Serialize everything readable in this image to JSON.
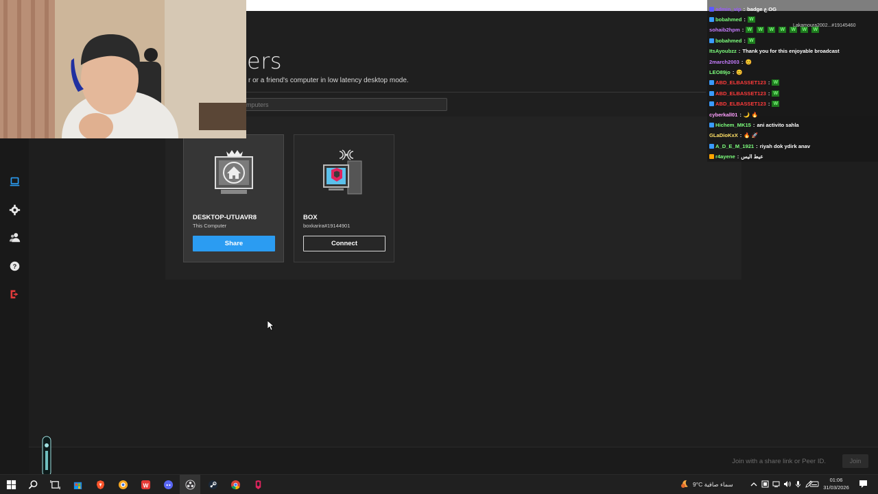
{
  "header": {
    "title": "ers",
    "subtitle": "r or a friend's computer in low latency desktop mode.",
    "search_placeholder": "mputers"
  },
  "sidebar": {
    "items": [
      {
        "name": "computers",
        "icon": "computer-icon",
        "active": true
      },
      {
        "name": "settings",
        "icon": "gear-icon"
      },
      {
        "name": "friends",
        "icon": "users-icon"
      },
      {
        "name": "help",
        "icon": "help-icon"
      },
      {
        "name": "logout",
        "icon": "logout-icon"
      }
    ]
  },
  "computers": [
    {
      "name": "DESKTOP-UTUAVR8",
      "sub": "This Computer",
      "button": "Share"
    },
    {
      "name": "BOX",
      "sub": "boxkarira#19144901",
      "button": "Connect"
    }
  ],
  "join": {
    "placeholder": "Join with a share link or Peer ID.",
    "button": "Join"
  },
  "chat": {
    "overlay_text": "Lakamoura2002...#19145460",
    "messages": [
      {
        "user": "admin_vip",
        "text": "badge ع OG",
        "color": "#9b59ff",
        "badge": "#5b5bff"
      },
      {
        "user": "bobahmed",
        "text": "",
        "w": 1,
        "color": "#7dff7d",
        "badge": "#3a9bff"
      },
      {
        "user": "sohaib2hpm",
        "text": "",
        "w": 7,
        "color": "#c77dff",
        "badge": null
      },
      {
        "user": "bobahmed",
        "text": "",
        "w": 1,
        "color": "#7dff7d",
        "badge": "#3a9bff"
      },
      {
        "user": "ItsAyoubzz",
        "text": "Thank you for this enjoyable broadcast",
        "color": "#7dff7d",
        "badge": null
      },
      {
        "user": "2march2003",
        "text": "😊",
        "color": "#c77dff",
        "badge": null
      },
      {
        "user": "LEO89jo",
        "text": "😊",
        "color": "#7dff7d",
        "badge": null
      },
      {
        "user": "ABD_ELBASSET123",
        "text": "",
        "w": 1,
        "color": "#ff3b3b",
        "badge": "#3a9bff"
      },
      {
        "user": "ABD_ELBASSET123",
        "text": "",
        "w": 1,
        "color": "#ff3b3b",
        "badge": "#3a9bff"
      },
      {
        "user": "ABD_ELBASSET123",
        "text": "",
        "w": 1,
        "color": "#ff3b3b",
        "badge": "#3a9bff"
      },
      {
        "user": "cyberkall01",
        "text": "🌙 🔥",
        "color": "#ffa0ff",
        "badge": null
      },
      {
        "user": "Hichem_MK15",
        "text": "ani activito sahla",
        "color": "#7dff7d",
        "badge": "#3a9bff"
      },
      {
        "user": "GLaDioKxX",
        "text": "🔥 🚀",
        "color": "#ffe066",
        "badge": null
      },
      {
        "user": "A_D_E_M_1921",
        "text": "riyah dok ydirk anav",
        "color": "#7dff7d",
        "badge": "#3a9bff"
      },
      {
        "user": "r4ayene",
        "text": "عيط اليس",
        "color": "#7dff7d",
        "badge": "#ffa500"
      }
    ]
  },
  "taskbar": {
    "weather": "9°C  سماء صافية",
    "time": "01:06",
    "date": "31/03/2026"
  }
}
